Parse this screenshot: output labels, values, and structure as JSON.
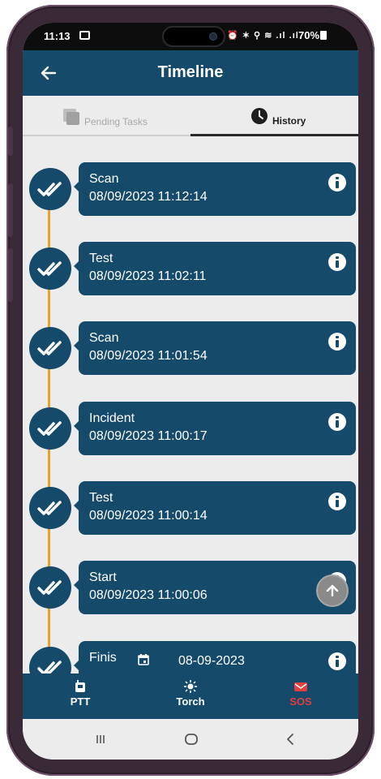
{
  "status": {
    "time": "11:13",
    "battery": "70%",
    "signal_text": "⏰ ✶ ⚲ ≋ .ıl .ıl"
  },
  "app_bar": {
    "title": "Timeline"
  },
  "tabs": [
    {
      "label": "Pending Tasks",
      "active": false
    },
    {
      "label": "History",
      "active": true
    }
  ],
  "timeline": {
    "items": [
      {
        "title": "Scan",
        "timestamp": "08/09/2023 11:12:14"
      },
      {
        "title": "Test",
        "timestamp": "08/09/2023 11:02:11"
      },
      {
        "title": "Scan",
        "timestamp": "08/09/2023 11:01:54"
      },
      {
        "title": "Incident",
        "timestamp": "08/09/2023 11:00:17"
      },
      {
        "title": "Test",
        "timestamp": "08/09/2023 11:00:14"
      },
      {
        "title": "Start",
        "timestamp": "08/09/2023 11:00:06"
      },
      {
        "title": "Finis",
        "timestamp": ""
      }
    ]
  },
  "date_selector": {
    "value": "08-09-2023"
  },
  "bottom_nav": [
    {
      "label": "PTT"
    },
    {
      "label": "Torch"
    },
    {
      "label": "SOS"
    }
  ],
  "colors": {
    "primary": "#154a6a",
    "timeline_line": "#e8a12d",
    "sos": "#e0403f"
  }
}
